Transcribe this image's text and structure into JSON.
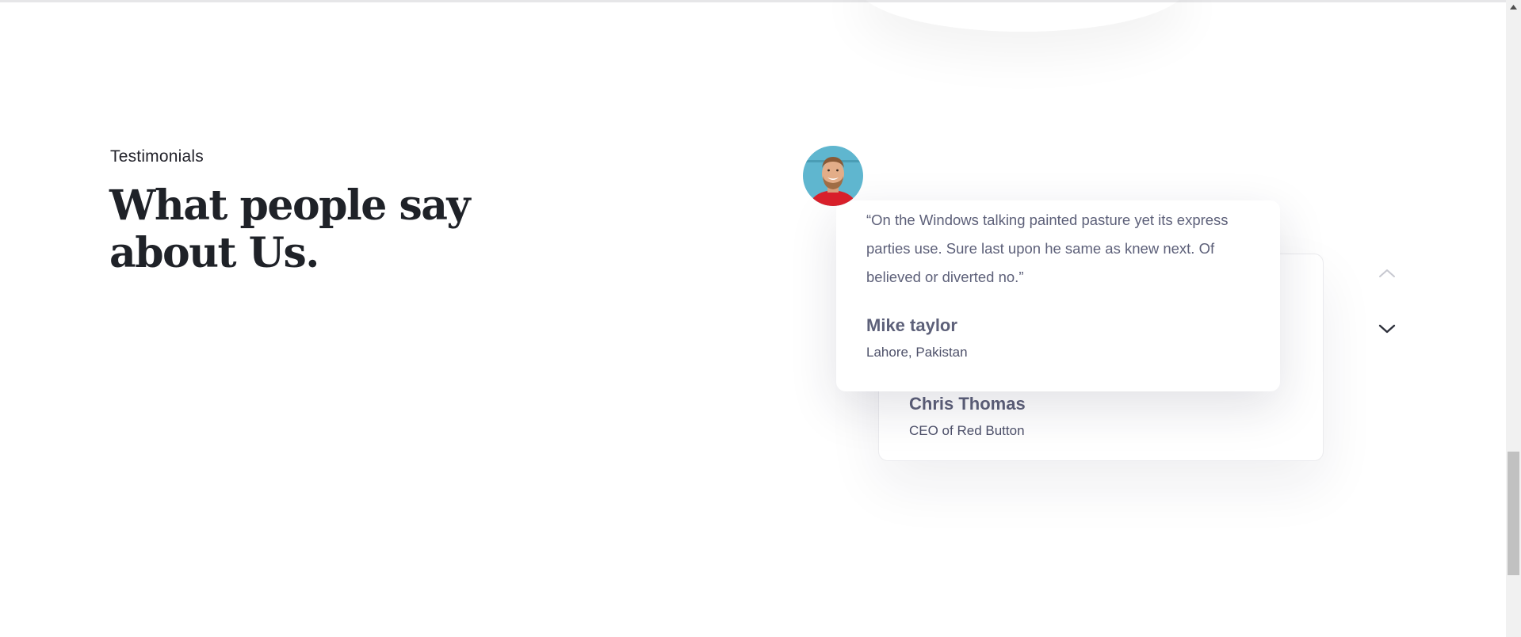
{
  "section": {
    "eyebrow": "Testimonials",
    "heading": "What people say about Us."
  },
  "testimonials": [
    {
      "quote": "“On the Windows talking painted pasture yet its express parties use. Sure last upon he same as knew next. Of believed or diverted no.”",
      "name": "Mike taylor",
      "subtitle": "Lahore, Pakistan",
      "avatar": "smiling-man-avatar",
      "state": "active"
    },
    {
      "name": "Chris Thomas",
      "subtitle": "CEO of Red Button",
      "state": "behind"
    }
  ],
  "controls": {
    "previous_icon": "chevron-up-icon",
    "next_icon": "chevron-down-icon"
  },
  "colors": {
    "heading": "#1f2228",
    "body_text": "#5d6079",
    "avatar_bg": "#5fb6cf",
    "shirt": "#d81f2a",
    "scroll_thumb": "#c1c1c1"
  }
}
